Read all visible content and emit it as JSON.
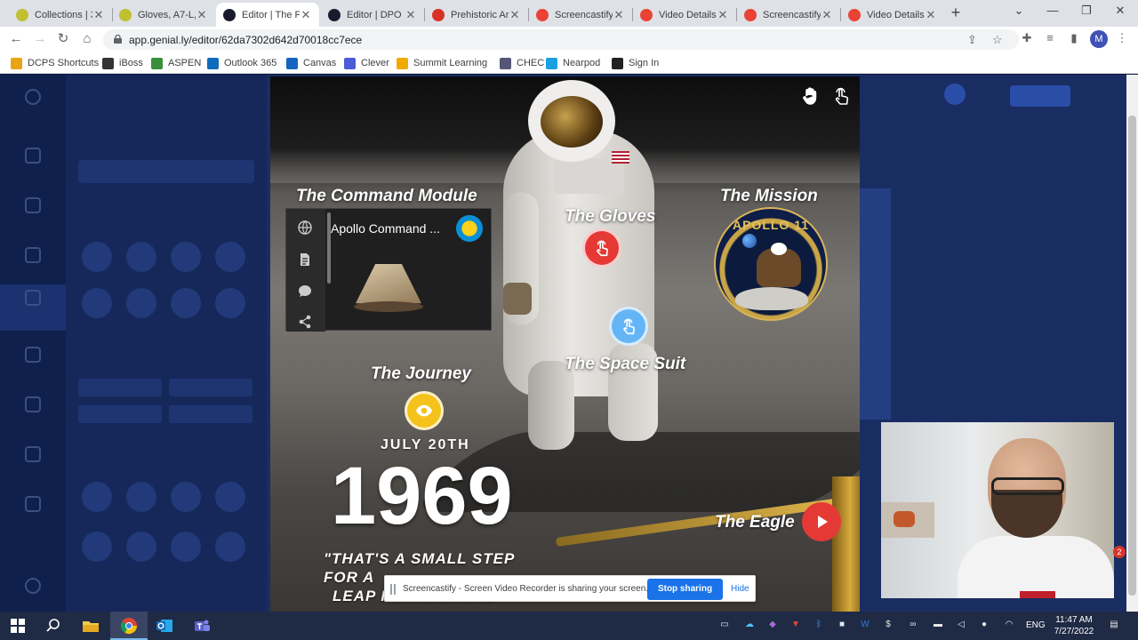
{
  "browser": {
    "tabs": [
      {
        "title": "Collections | 3",
        "color": "#c0c030"
      },
      {
        "title": "Gloves, A7-L, I",
        "color": "#c0c030"
      },
      {
        "title": "Editor | The Fi",
        "color": "#1a1a2e"
      },
      {
        "title": "Editor | DPO C",
        "color": "#1a1a2e"
      },
      {
        "title": "Prehistoric Ar",
        "color": "#d93025"
      },
      {
        "title": "Screencastify",
        "color": "#ea4335"
      },
      {
        "title": "Video Details",
        "color": "#ea4335"
      },
      {
        "title": "Screencastify",
        "color": "#ea4335"
      },
      {
        "title": "Video Details",
        "color": "#ea4335"
      }
    ],
    "active_tab_index": 2,
    "url": "app.genial.ly/editor/62da7302d642d70018cc7ece",
    "profile_initial": "M"
  },
  "bookmarks": [
    {
      "label": "DCPS Shortcuts",
      "color": "#e8a317"
    },
    {
      "label": "iBoss",
      "color": "#333333"
    },
    {
      "label": "ASPEN",
      "color": "#3a8f3a"
    },
    {
      "label": "Outlook 365",
      "color": "#0f6cbd"
    },
    {
      "label": "Canvas",
      "color": "#1565c0"
    },
    {
      "label": "Clever",
      "color": "#4a5bd6"
    },
    {
      "label": "Summit Learning",
      "color": "#f2a900"
    },
    {
      "label": "CHEC",
      "color": "#555577"
    },
    {
      "label": "Nearpod",
      "color": "#1ba0e1"
    },
    {
      "label": "Sign In",
      "color": "#222222"
    }
  ],
  "slide": {
    "titles": {
      "command_module": "The Command Module",
      "gloves": "The Gloves",
      "mission": "The Mission",
      "space_suit": "The Space Suit",
      "journey": "The Journey",
      "eagle": "The Eagle"
    },
    "embed": {
      "title": "Apollo Command ..."
    },
    "badge_text": "APOLLO 11",
    "date": "JULY 20TH",
    "year": "1969",
    "quote_lines": [
      "\"THAT'S A SMALL STEP",
      "FOR A",
      "LEAP FOR MANKIND"
    ],
    "hotspot_colors": {
      "gloves": "#e53935",
      "space_suit": "#64b5f6",
      "journey": "#f4c21a",
      "eagle": "#e53935"
    }
  },
  "screencastify": {
    "message": "Screencastify - Screen Video Recorder is sharing your screen.",
    "stop_label": "Stop sharing",
    "hide_label": "Hide"
  },
  "notification_count": "2",
  "taskbar": {
    "lang": "ENG",
    "time": "11:47 AM",
    "date": "7/27/2022"
  }
}
